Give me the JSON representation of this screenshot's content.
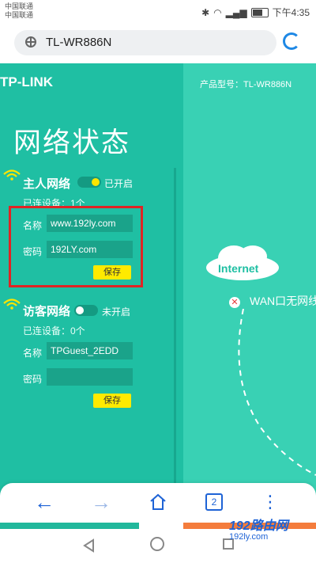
{
  "status_bar": {
    "carrier1": "中国联通",
    "carrier2": "中国联通",
    "time": "下午4:35"
  },
  "browser": {
    "url": "TL-WR886N"
  },
  "router": {
    "logo": "TP-LINK",
    "model_label": "产品型号：TL-WR886N",
    "page_title": "网络状态",
    "host_network": {
      "title": "主人网络",
      "state": "已开启",
      "connected": "已连设备：1个",
      "name_label": "名称",
      "name_value": "www.192ly.com",
      "password_label": "密码",
      "password_value": "192LY.com",
      "save_label": "保存"
    },
    "guest_network": {
      "title": "访客网络",
      "state": "未开启",
      "connected": "已连设备：0个",
      "name_label": "名称",
      "name_value": "TPGuest_2EDD",
      "password_label": "密码",
      "password_value": "",
      "save_label": "保存"
    },
    "internet_label": "Internet",
    "wan_status": "WAN口无网线"
  },
  "browser_nav": {
    "back_icon": "←",
    "forward_icon": "→",
    "tabs_count": "2",
    "menu_icon": "⋮"
  },
  "watermark": {
    "brand": "192路由网",
    "url": "192ly.com"
  },
  "colors": {
    "page_bg": "#1fbfa3",
    "accent_blue": "#1e63d6",
    "highlight_red": "#e02424",
    "save_yellow": "#ffea00"
  }
}
